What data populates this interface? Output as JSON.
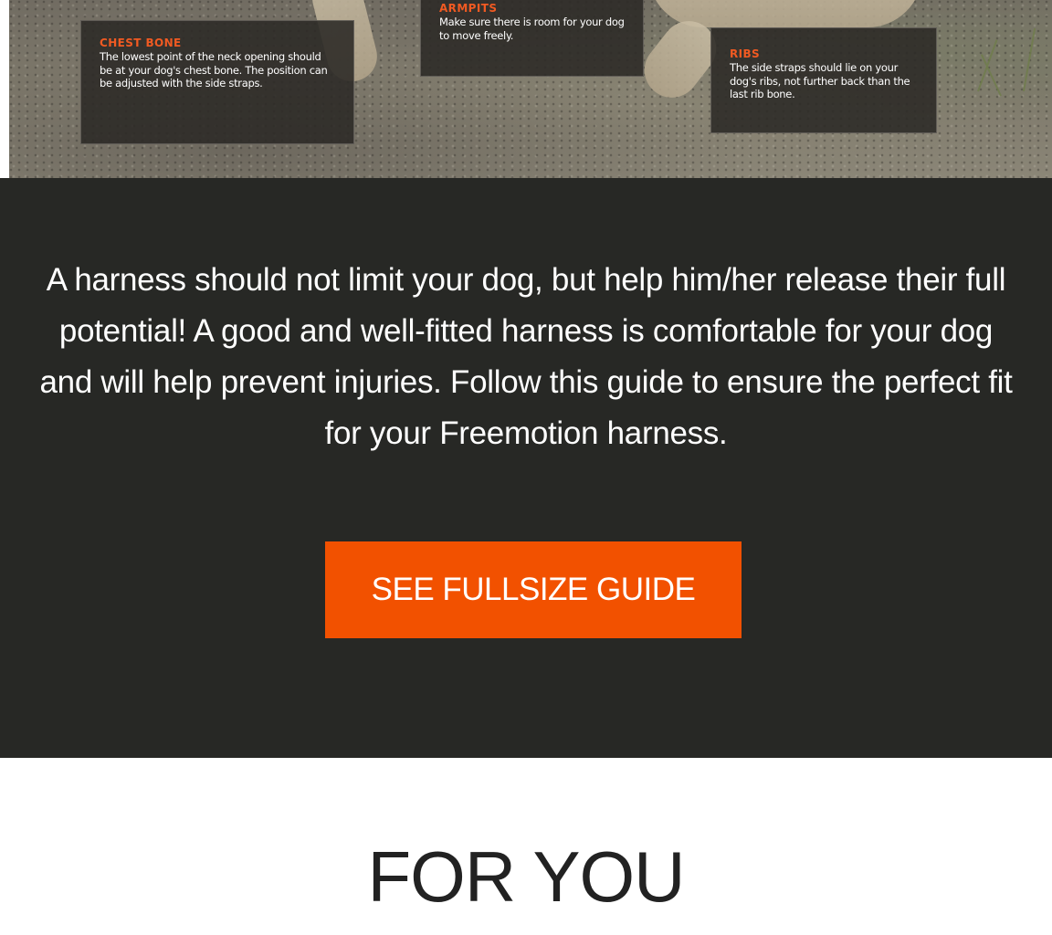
{
  "guide_image": {
    "callouts": [
      {
        "id": "chest-bone",
        "title": "CHEST BONE",
        "body": "The lowest point of the neck opening should be at your dog's chest bone. The position can be adjusted with the side straps."
      },
      {
        "id": "armpits",
        "title": "ARMPITS",
        "body": "Make sure there is room for your dog to move freely."
      },
      {
        "id": "ribs",
        "title": "RIBS",
        "body": "The side straps should lie on your dog's ribs, not further back than the last rib bone."
      }
    ]
  },
  "intro": {
    "text": "A harness should not limit your dog, but help him/her release their full potential! A good and well-fitted harness is comfortable for your dog and will help prevent injuries. Follow this guide to ensure the perfect fit for your Freemotion harness."
  },
  "cta": {
    "label": "SEE FULLSIZE GUIDE"
  },
  "for_you": {
    "title": "FOR YOU"
  },
  "colors": {
    "accent": "#f25100",
    "dark_band": "#272825",
    "callout_title": "#f15a22"
  }
}
